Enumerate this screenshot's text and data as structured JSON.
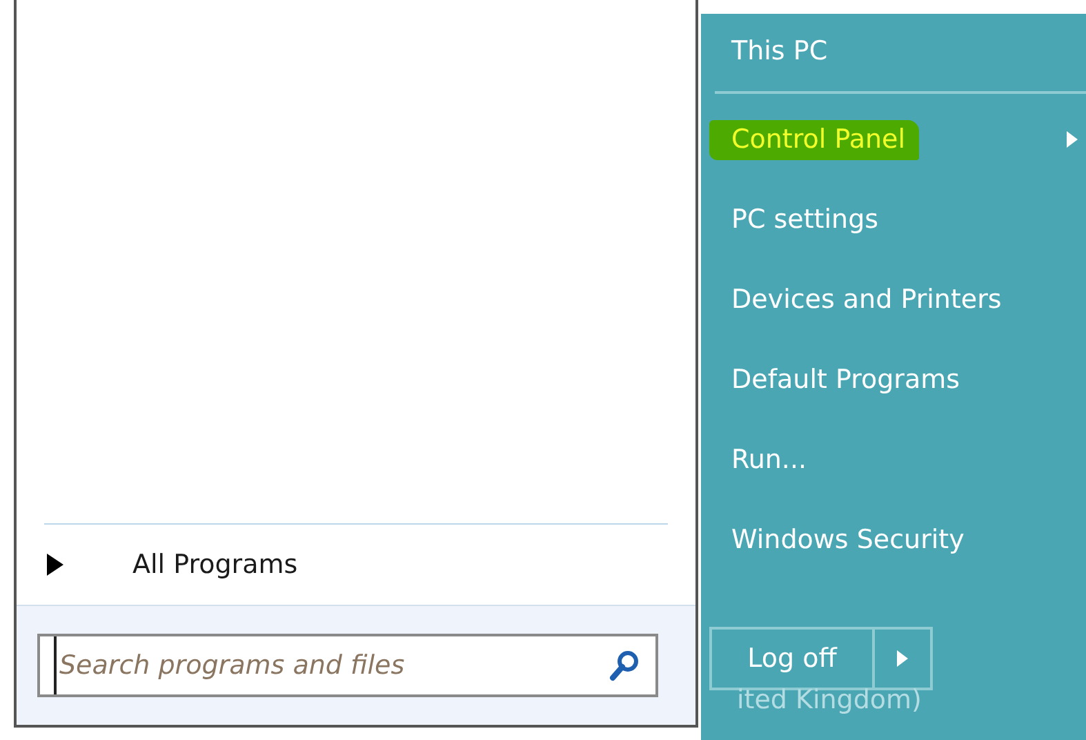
{
  "left_pane": {
    "all_programs": {
      "label": "All Programs"
    },
    "search": {
      "placeholder": "Search programs and files"
    }
  },
  "right_pane": {
    "items": [
      {
        "label": "This PC",
        "highlighted": false,
        "submenu": false,
        "separator_after": true
      },
      {
        "label": "Control Panel",
        "highlighted": true,
        "submenu": true,
        "separator_after": false
      },
      {
        "label": "PC settings",
        "highlighted": false,
        "submenu": false,
        "separator_after": false
      },
      {
        "label": "Devices and Printers",
        "highlighted": false,
        "submenu": false,
        "separator_after": false
      },
      {
        "label": "Default Programs",
        "highlighted": false,
        "submenu": false,
        "separator_after": false
      },
      {
        "label": "Run...",
        "highlighted": false,
        "submenu": false,
        "separator_after": false
      },
      {
        "label": "Windows Security",
        "highlighted": false,
        "submenu": false,
        "separator_after": false
      }
    ],
    "shutdown": {
      "label": "Log off"
    },
    "background_text": "ited Kingdom)"
  }
}
